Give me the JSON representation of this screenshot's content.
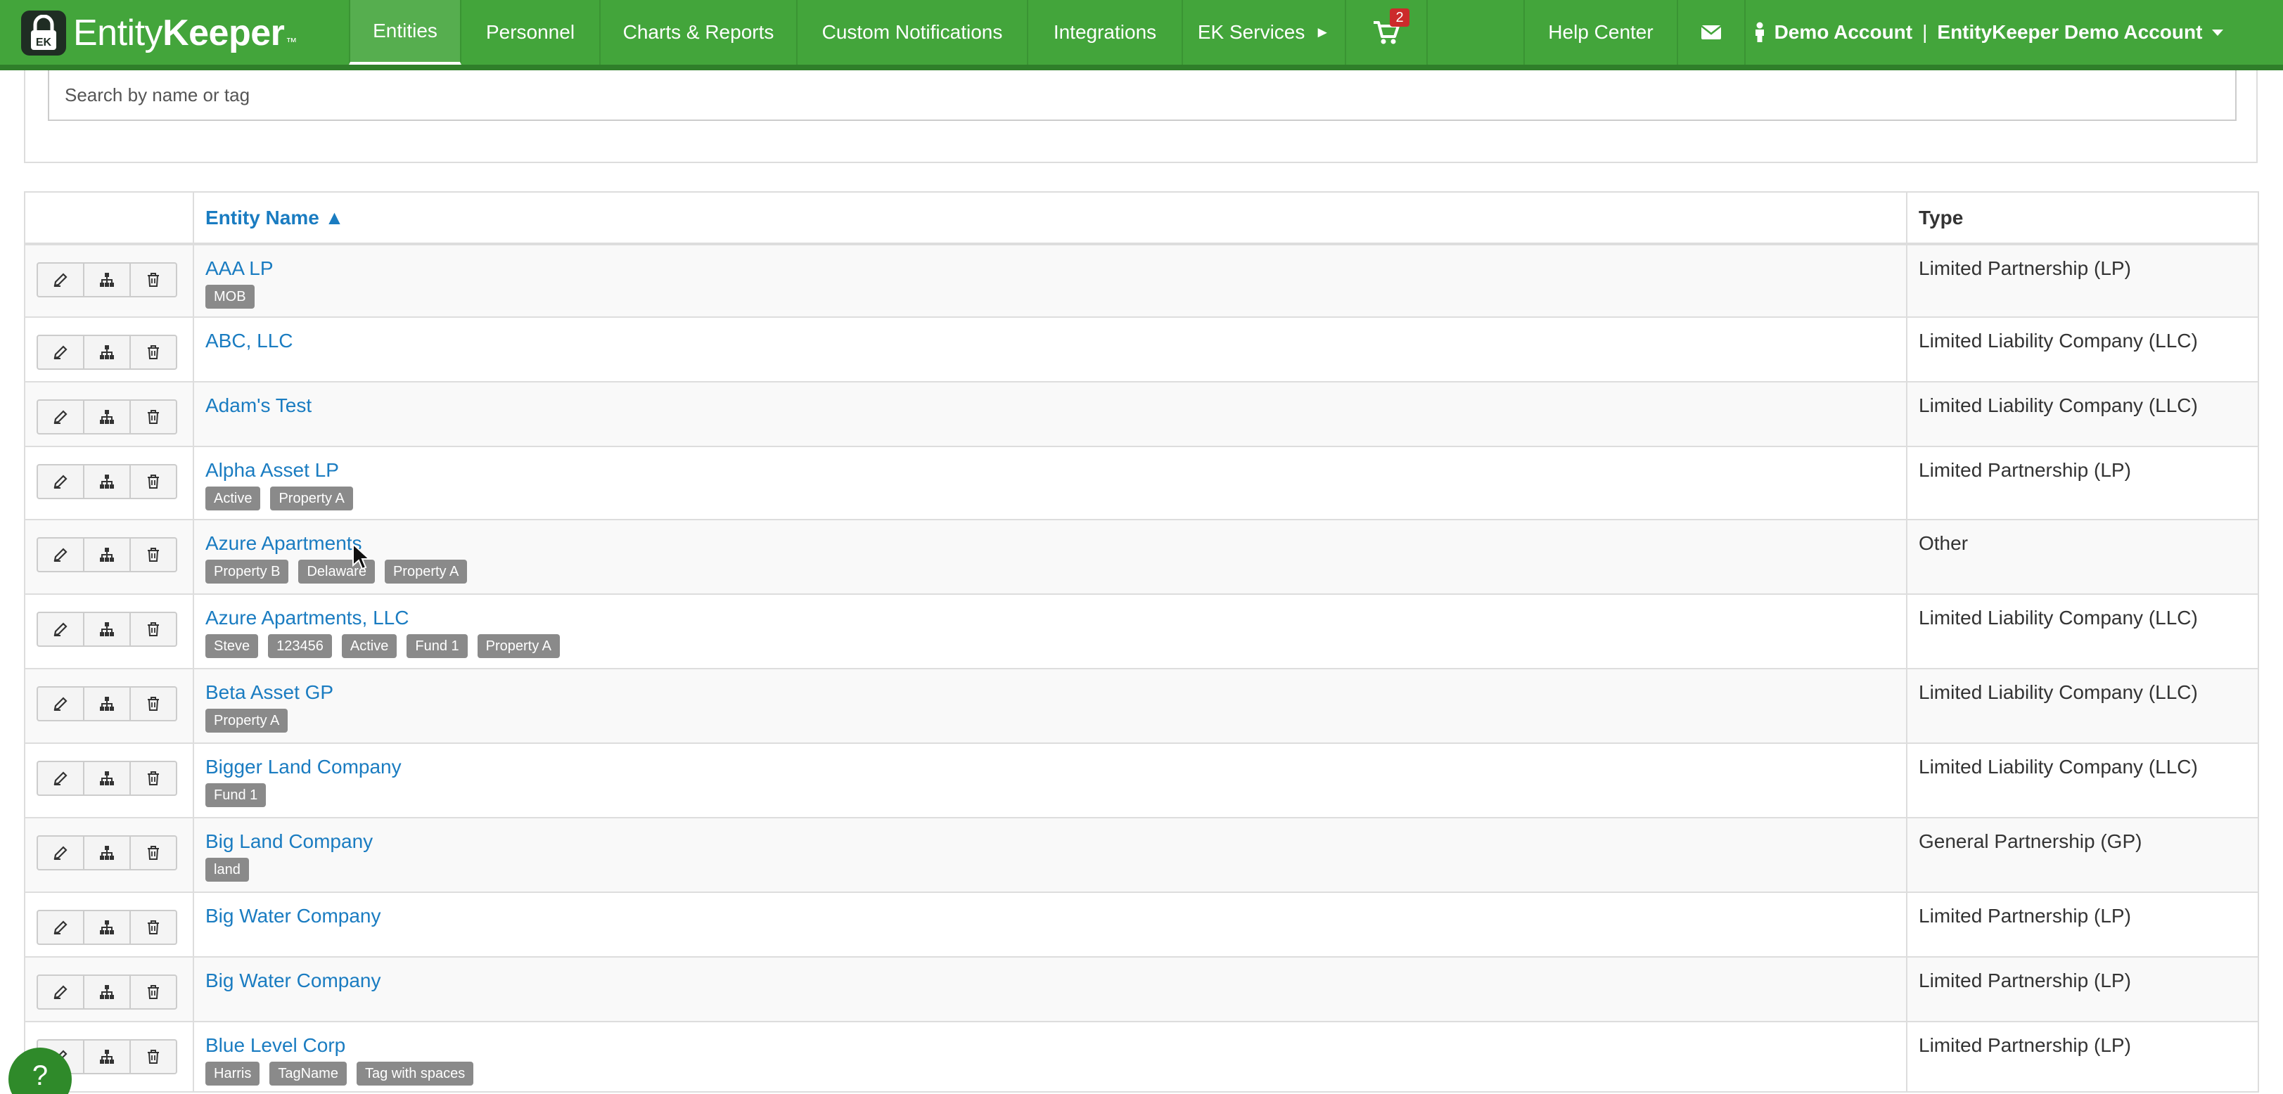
{
  "brand": {
    "name_part1": "Entity",
    "name_part2": "Keeper",
    "tm": "™",
    "lock_label": "EK"
  },
  "nav": {
    "items": [
      {
        "label": "Entities"
      },
      {
        "label": "Personnel"
      },
      {
        "label": "Charts & Reports"
      },
      {
        "label": "Custom Notifications"
      },
      {
        "label": "Integrations"
      },
      {
        "label": "EK Services"
      }
    ],
    "ek_services_arrow": "►",
    "cart_count": "2",
    "help_center": "Help Center",
    "account_user": "Demo Account",
    "account_separator": "|",
    "account_org": "EntityKeeper Demo Account"
  },
  "search": {
    "placeholder": "Search by name or tag"
  },
  "table": {
    "col_name": "Entity Name ▲",
    "col_type": "Type",
    "rows": [
      {
        "name": "AAA LP",
        "type": "Limited Partnership (LP)",
        "tags": [
          "MOB"
        ]
      },
      {
        "name": "ABC, LLC",
        "type": "Limited Liability Company (LLC)",
        "tags": []
      },
      {
        "name": "Adam's Test",
        "type": "Limited Liability Company (LLC)",
        "tags": []
      },
      {
        "name": "Alpha Asset LP",
        "type": "Limited Partnership (LP)",
        "tags": [
          "Active",
          "Property A"
        ]
      },
      {
        "name": "Azure Apartments",
        "type": "Other",
        "tags": [
          "Property B",
          "Delaware",
          "Property A"
        ]
      },
      {
        "name": "Azure Apartments, LLC",
        "type": "Limited Liability Company (LLC)",
        "tags": [
          "Steve",
          "123456",
          "Active",
          "Fund 1",
          "Property A"
        ]
      },
      {
        "name": "Beta Asset GP",
        "type": "Limited Liability Company (LLC)",
        "tags": [
          "Property A"
        ]
      },
      {
        "name": "Bigger Land Company",
        "type": "Limited Liability Company (LLC)",
        "tags": [
          "Fund 1"
        ]
      },
      {
        "name": "Big Land Company",
        "type": "General Partnership (GP)",
        "tags": [
          "land"
        ]
      },
      {
        "name": "Big Water Company",
        "type": "Limited Partnership (LP)",
        "tags": []
      },
      {
        "name": "Big Water Company",
        "type": "Limited Partnership (LP)",
        "tags": []
      },
      {
        "name": "Blue Level Corp",
        "type": "Limited Partnership (LP)",
        "tags": [
          "Harris",
          "TagName",
          "Tag with spaces"
        ]
      }
    ]
  },
  "help": {
    "label": "?"
  },
  "colors": {
    "navbar": "#43a53b",
    "link": "#1a7cc1",
    "tag": "#8a8a8a",
    "badge": "#cc2b2b"
  }
}
